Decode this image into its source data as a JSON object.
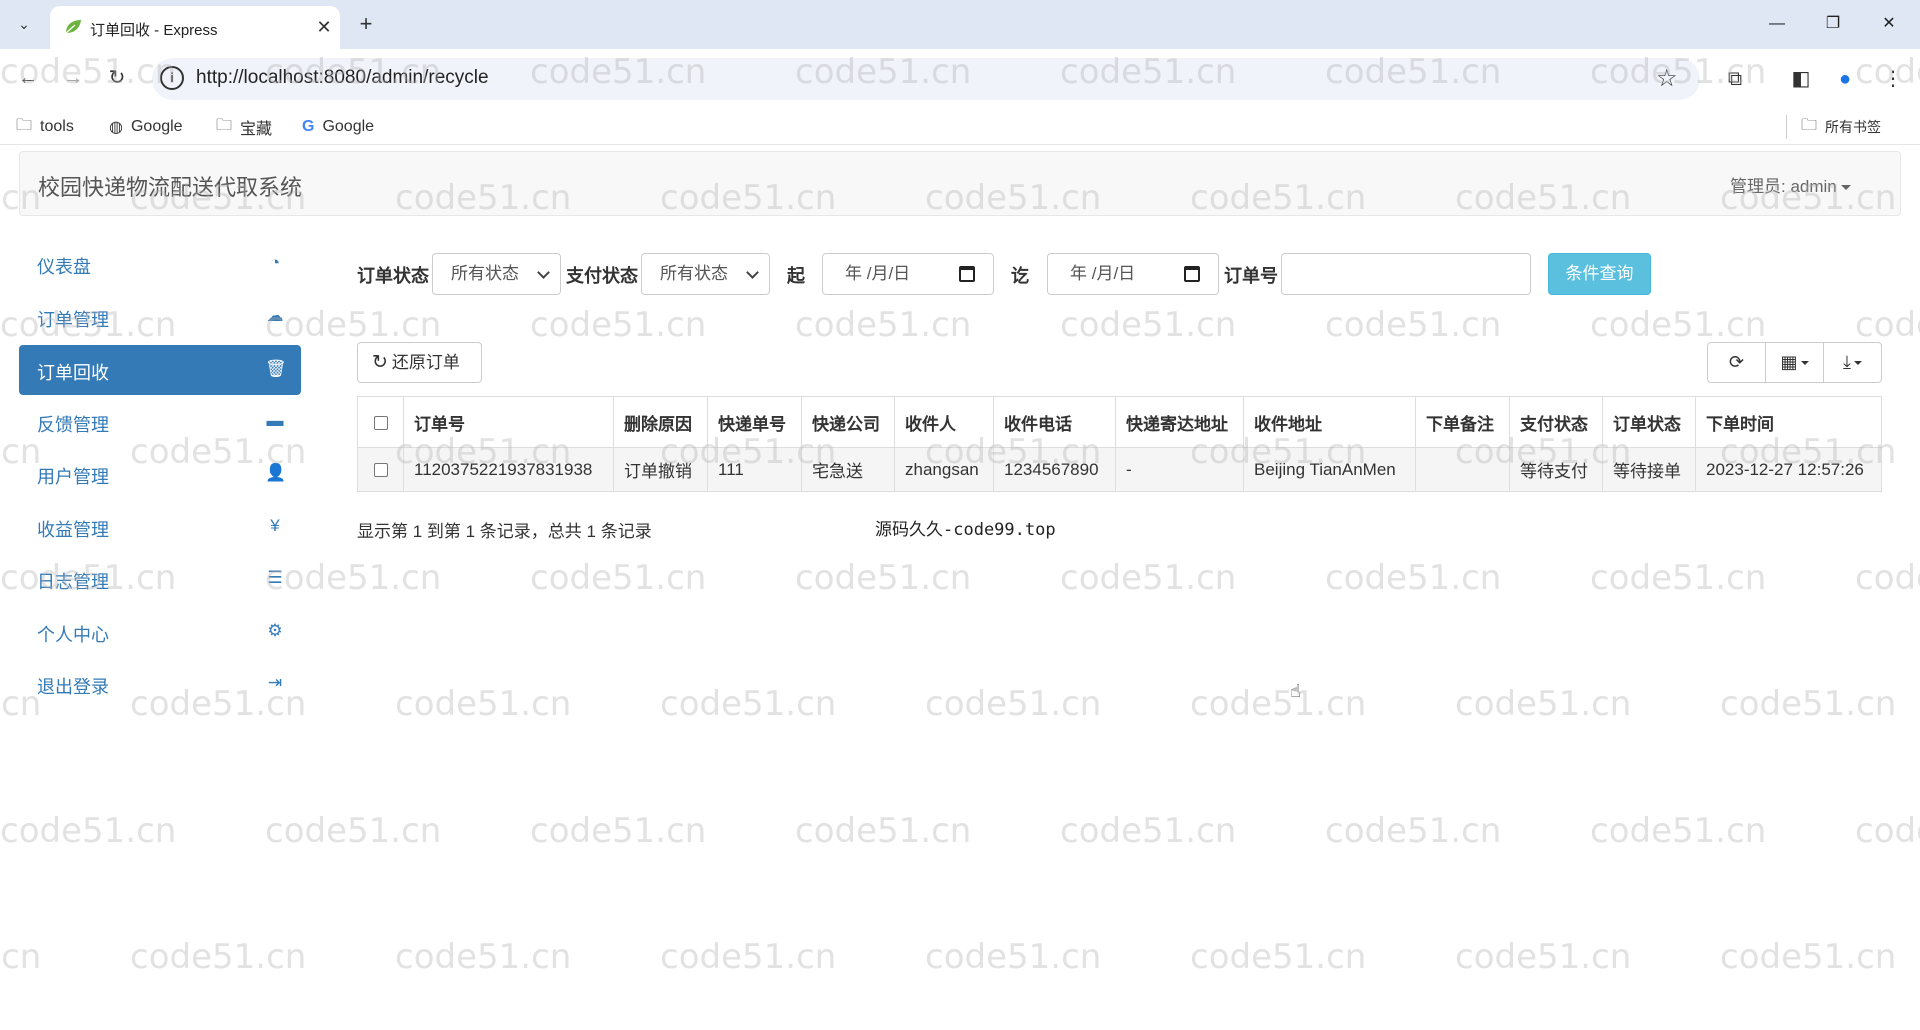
{
  "browser": {
    "tab_title": "订单回收 - Express",
    "url": "http://localhost:8080/admin/recycle",
    "bookmarks": [
      "tools",
      "Google",
      "宝藏",
      "Google"
    ],
    "all_bookmarks": "所有书签"
  },
  "app": {
    "title": "校园快递物流配送代取系统",
    "admin_label": "管理员: admin"
  },
  "sidebar": {
    "items": [
      {
        "label": "仪表盘",
        "icon": "dashboard-icon"
      },
      {
        "label": "订单管理",
        "icon": "cloud-upload-icon"
      },
      {
        "label": "订单回收",
        "icon": "trash-icon",
        "active": true
      },
      {
        "label": "反馈管理",
        "icon": "comment-icon"
      },
      {
        "label": "用户管理",
        "icon": "user-icon"
      },
      {
        "label": "收益管理",
        "icon": "yen-icon"
      },
      {
        "label": "日志管理",
        "icon": "list-icon"
      },
      {
        "label": "个人中心",
        "icon": "gear-icon"
      },
      {
        "label": "退出登录",
        "icon": "logout-icon"
      }
    ]
  },
  "filters": {
    "order_status_label": "订单状态",
    "order_status_value": "所有状态",
    "pay_status_label": "支付状态",
    "pay_status_value": "所有状态",
    "start_label": "起",
    "start_placeholder": "年 /月/日",
    "end_label": "讫",
    "end_placeholder": "年 /月/日",
    "order_no_label": "订单号",
    "order_no_value": "",
    "search_button": "条件查询"
  },
  "toolbar": {
    "restore_button": "还原订单"
  },
  "table": {
    "headers": [
      "订单号",
      "删除原因",
      "快递单号",
      "快递公司",
      "收件人",
      "收件电话",
      "快递寄达地址",
      "收件地址",
      "下单备注",
      "支付状态",
      "订单状态",
      "下单时间"
    ],
    "rows": [
      {
        "order_no": "1120375221937831938",
        "delete_reason": "订单撤销",
        "tracking_no": "111",
        "courier": "宅急送",
        "recipient": "zhangsan",
        "phone": "1234567890",
        "send_address": "-",
        "receive_address": "Beijing TianAnMen",
        "remark": "",
        "pay_status": "等待支付",
        "order_status": "等待接单",
        "order_time": "2023-12-27 12:57:26"
      }
    ]
  },
  "pager": {
    "info": "显示第 1 到第 1 条记录，总共 1 条记录"
  },
  "footer_note": "源码久久-code99.top",
  "watermark": "code51.cn",
  "colors": {
    "primary": "#337ab7",
    "info_button": "#5bc0de",
    "warning": "#f0ad4e",
    "tab_strip": "#dfe7f5"
  }
}
